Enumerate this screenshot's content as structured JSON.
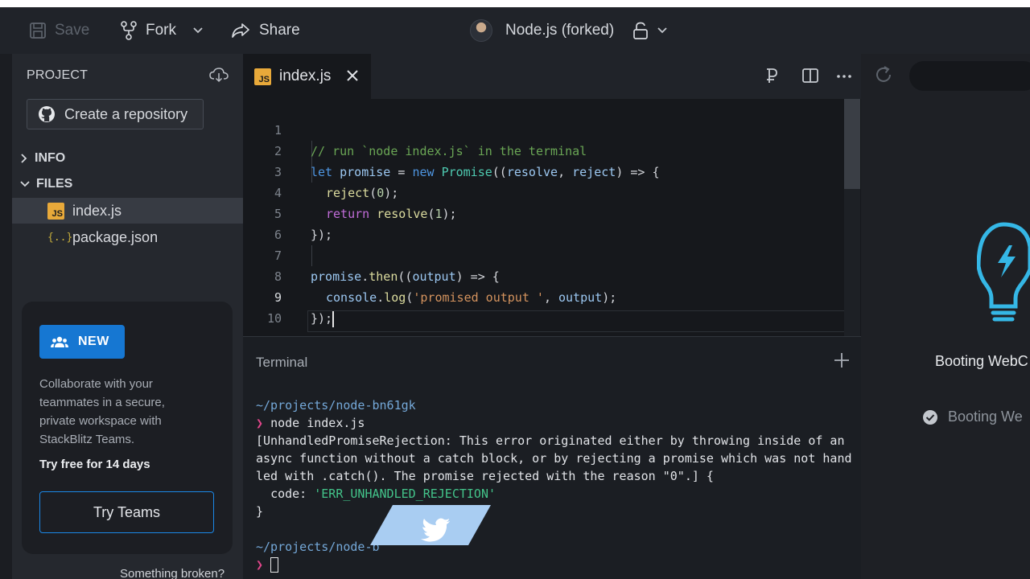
{
  "toolbar": {
    "save_label": "Save",
    "fork_label": "Fork",
    "share_label": "Share",
    "project_title": "Node.js (forked)"
  },
  "sidebar": {
    "header": "PROJECT",
    "create_repo_label": "Create a repository",
    "sections": {
      "info": "INFO",
      "files": "FILES"
    },
    "files": [
      {
        "name": "index.js",
        "icon": "js-file-icon",
        "active": true
      },
      {
        "name": "package.json",
        "icon": "json-file-icon",
        "active": false
      }
    ],
    "promo": {
      "badge": "NEW",
      "text": "Collaborate with your teammates in a secure, private workspace with StackBlitz Teams.",
      "bold": "Try free for 14 days",
      "button": "Try Teams"
    },
    "footer": "Something broken?"
  },
  "editor": {
    "tab_label": "index.js",
    "tab_icon_text": "JS",
    "line_numbers": [
      "1",
      "2",
      "3",
      "4",
      "5",
      "6",
      "7",
      "8",
      "9",
      "10"
    ],
    "current_line": "9",
    "code": {
      "l1": "// run `node index.js` in the terminal",
      "l2_let": "let",
      "l2_var": "promise",
      "l2_eq": " = ",
      "l2_new": "new",
      "l2_cls": "Promise",
      "l2_open": "((",
      "l2_p1": "resolve",
      "l2_comma": ", ",
      "l2_p2": "reject",
      "l2_arrow": ") => {",
      "l3_fn": "reject",
      "l3_open": "(",
      "l3_num": "0",
      "l3_close": ");",
      "l4_kw": "return",
      "l4_fn": "resolve",
      "l4_open": "(",
      "l4_num": "1",
      "l4_close": ");",
      "l5": "});",
      "l7_var": "promise",
      "l7_dot": ".",
      "l7_fn": "then",
      "l7_open": "((",
      "l7_p": "output",
      "l7_arrow": ") => {",
      "l8_obj": "console",
      "l8_dot": ".",
      "l8_fn": "log",
      "l8_open": "(",
      "l8_str": "'promised output '",
      "l8_comma": ", ",
      "l8_p": "output",
      "l8_close": ");",
      "l9": "});"
    }
  },
  "terminal": {
    "title": "Terminal",
    "path1": "~/projects/node-bn61gk",
    "prompt_symbol": "❯",
    "command": "node index.js",
    "error": "[UnhandledPromiseRejection: This error originated either by throwing inside of an async function without a catch block, or by rejecting a promise which was not handled with .catch(). The promise rejected with the reason \"0\".] {",
    "code_key": "  code: ",
    "code_value": "'ERR_UNHANDLED_REJECTION'",
    "close_brace": "}",
    "path2": "~/projects/node-b"
  },
  "preview": {
    "booting_title": "Booting WebC",
    "booting_step": "Booting We"
  },
  "colors": {
    "accent_blue": "#1677d2",
    "bulb": "#35b7e6",
    "js_badge": "#e8a93a"
  }
}
